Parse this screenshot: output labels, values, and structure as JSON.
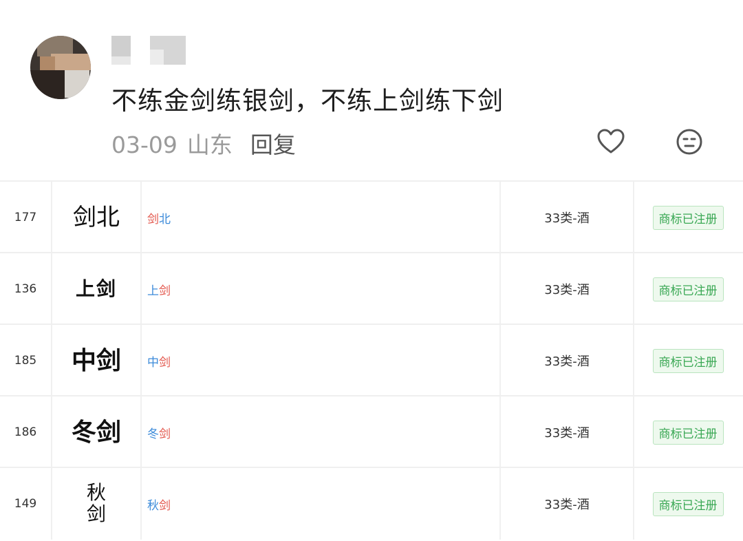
{
  "comment": {
    "text": "不练金剑练银剑，不练上剑练下剑",
    "date": "03-09",
    "location": "山东",
    "reply_label": "回复",
    "like_icon": "heart-outline-icon",
    "emoji_icon": "face-emoji-icon"
  },
  "trademarks": [
    {
      "number": "177",
      "logo": "剑北",
      "name_parts": [
        "剑",
        "北"
      ],
      "class": "33类-酒",
      "status": "商标已注册"
    },
    {
      "number": "136",
      "logo": "上剑",
      "name_parts": [
        "上",
        "剑"
      ],
      "class": "33类-酒",
      "status": "商标已注册"
    },
    {
      "number": "185",
      "logo": "中剑",
      "name_parts": [
        "中",
        "剑"
      ],
      "class": "33类-酒",
      "status": "商标已注册"
    },
    {
      "number": "186",
      "logo": "冬剑",
      "name_parts": [
        "冬",
        "剑"
      ],
      "class": "33类-酒",
      "status": "商标已注册"
    },
    {
      "number": "149",
      "logo": "秋剑",
      "name_parts": [
        "秋",
        "剑"
      ],
      "class": "33类-酒",
      "status": "商标已注册"
    }
  ],
  "colors": {
    "status_green": "#3aa854",
    "name_red": "#e2544a",
    "name_blue": "#3b8ad9",
    "meta_gray": "#9a9a9a"
  }
}
